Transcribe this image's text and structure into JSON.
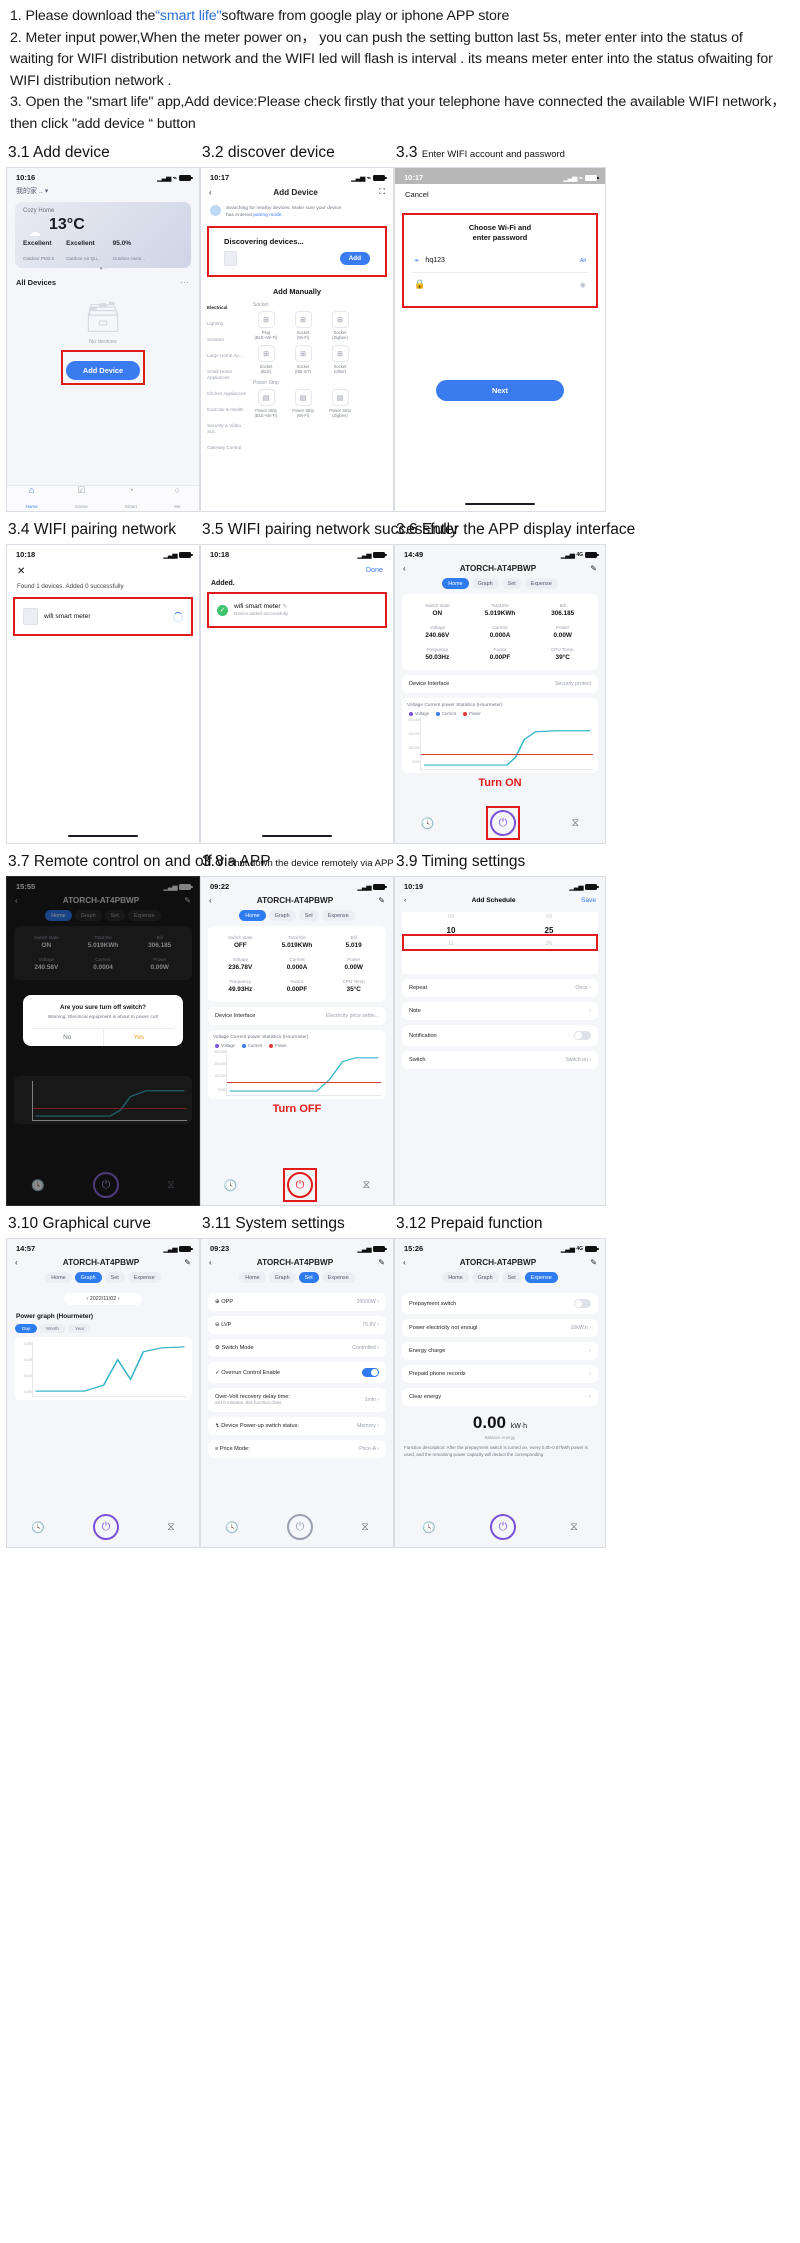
{
  "intro": {
    "line1_a": "1. Please download the",
    "line1_link": "“smart life\"",
    "line1_b": "software from google play or  iphone APP store",
    "line2": "2. Meter input power,When the meter power on， you can push the setting button last 5s, meter enter into the status of waiting for WIFI distribution network and the WIFI led will flash is interval . its means meter enter into the status ofwaiting for WIFI distribution network .",
    "line3": "3. Open the \"smart life\" app,Add device:Please check firstly that your telephone have connected the available WIFI network， then click \"add device “ button"
  },
  "sections": {
    "s31": {
      "num": "3.1",
      "title": "Add device"
    },
    "s32": {
      "num": "3.2",
      "title": "discover device"
    },
    "s33": {
      "num": "3.3",
      "title": "Enter WIFI account and password"
    },
    "s34": {
      "num": "3.4",
      "title": "WIFI pairing network"
    },
    "s35": {
      "num": "3.5",
      "title": "WIFI pairing network successfully"
    },
    "s36": {
      "num": "3.6",
      "title": "Enter the APP display interface"
    },
    "s37": {
      "num": "3.7",
      "title": "Remote control on and off via APP"
    },
    "s38": {
      "num": "3.8",
      "title": "Shut down the device remotely via APP"
    },
    "s39": {
      "num": "3.9",
      "title": "Timing settings"
    },
    "s310": {
      "num": "3.10",
      "title": "Graphical curve"
    },
    "s311": {
      "num": "3.11",
      "title": "System settings"
    },
    "s312": {
      "num": "3.12",
      "title": "Prepaid function"
    }
  },
  "phone31": {
    "time": "10:16",
    "home_name": "我的家 ..",
    "card_title": "Cozy Home",
    "temp": "13°C",
    "m1_value": "Excellent",
    "m1_label": "Outdoor PM2.5",
    "m2_value": "Excellent",
    "m2_label": "Outdoor Air Qu...",
    "m3_value": "95.0%",
    "m3_label": "Outdoor Humi...",
    "all_devices": "All Devices",
    "no_devices": "No devices",
    "add_device": "Add Device",
    "tabs": [
      {
        "icon": "⌂",
        "label": "Home"
      },
      {
        "icon": "☑",
        "label": "Scene"
      },
      {
        "icon": "◔",
        "label": "Smart"
      },
      {
        "icon": "○",
        "label": "Me"
      }
    ]
  },
  "phone32": {
    "time": "10:17",
    "title": "Add Device",
    "note_a": "Searching for nearby devices. Make sure your device",
    "note_b": "has entered ",
    "note_link": "pairing mode.",
    "discovering": "Discovering devices...",
    "add_btn": "Add",
    "add_manually": "Add Manually",
    "categories": [
      "Electrical",
      "Lighting",
      "Sensors",
      "Large Home Ap...",
      "Small Home Appliances",
      "Kitchen Appliances",
      "Exercise & Health",
      "Security & Video Sur...",
      "Gateway Control"
    ],
    "group1": "Socket",
    "products1": [
      {
        "name": "Plug",
        "sub": "(BLE+Wi-Fi)"
      },
      {
        "name": "Socket",
        "sub": "(Wi-Fi)"
      },
      {
        "name": "Socket",
        "sub": "(Zigbee)"
      },
      {
        "name": "Socket",
        "sub": "(BLE)"
      },
      {
        "name": "Socket",
        "sub": "(NB-IoT)"
      },
      {
        "name": "Socket",
        "sub": "(other)"
      }
    ],
    "group2": "Power Strip",
    "products2": [
      {
        "name": "Power Strip",
        "sub": "(BLE+Wi-Fi)"
      },
      {
        "name": "Power Strip",
        "sub": "(Wi-Fi)"
      },
      {
        "name": "Power Strip",
        "sub": "(Zigbee)"
      }
    ]
  },
  "phone33": {
    "time": "10:17",
    "cancel": "Cancel",
    "title_l1": "Choose Wi-Fi and",
    "title_l2": "enter password",
    "ssid": "hq123",
    "switch": "Alt",
    "next": "Next"
  },
  "phone34": {
    "time": "10:18",
    "found": "Found 1 devices. Added 0 successfully",
    "device": "wifi smart meter"
  },
  "phone35": {
    "time": "10:18",
    "done": "Done",
    "added": "Added.",
    "device": "wifi smart meter",
    "sub": "Device added successfully"
  },
  "phone36": {
    "time": "14:49",
    "title": "ATORCH-AT4PBWP",
    "tabs": [
      "Home",
      "Graph",
      "Set",
      "Expense"
    ],
    "metrics": [
      {
        "k": "Switch state",
        "v": "ON"
      },
      {
        "k": "Total Ele",
        "v": "5.019KWh"
      },
      {
        "k": "Bill",
        "v": "306.185"
      },
      {
        "k": "Voltage",
        "v": "240.66V"
      },
      {
        "k": "Current",
        "v": "0.000A"
      },
      {
        "k": "Power",
        "v": "0.00W"
      },
      {
        "k": "Frequency",
        "v": "50.03Hz"
      },
      {
        "k": "Factor",
        "v": "0.00PF"
      },
      {
        "k": "CPU Temp.",
        "v": "39°C"
      }
    ],
    "row1_l": "Device Interface",
    "row1_r": "Security protect",
    "chart_title": "Voltage Current power Statistics (Hourmeter)",
    "legend": [
      "Voltage",
      "Current",
      "Power"
    ],
    "turn": "Turn ON"
  },
  "phone37": {
    "time": "15:55",
    "title": "ATORCH-AT4PBWP",
    "tabs": [
      "Home",
      "Graph",
      "Set",
      "Expense"
    ],
    "metrics": [
      {
        "k": "Switch state",
        "v": "ON"
      },
      {
        "k": "Total Ele",
        "v": "5.019KWh"
      },
      {
        "k": "Bill",
        "v": "306.185"
      },
      {
        "k": "Voltage",
        "v": "240.58V"
      },
      {
        "k": "Current",
        "v": "0.0004"
      },
      {
        "k": "Power",
        "v": "0.00W"
      }
    ],
    "dialog_title": "Are you sure turn off switch?",
    "dialog_body": "Warning: Electrical equipment is about to power cut!",
    "dialog_no": "No",
    "dialog_yes": "Yes"
  },
  "phone38": {
    "time": "09:22",
    "title": "ATORCH-AT4PBWP",
    "tabs": [
      "Home",
      "Graph",
      "Set",
      "Expense"
    ],
    "metrics": [
      {
        "k": "Switch state",
        "v": "OFF"
      },
      {
        "k": "Total Ele",
        "v": "5.019KWh"
      },
      {
        "k": "Bill",
        "v": "5.019"
      },
      {
        "k": "Voltage",
        "v": "236.78V"
      },
      {
        "k": "Current",
        "v": "0.000A"
      },
      {
        "k": "Power",
        "v": "0.00W"
      },
      {
        "k": "Frequency",
        "v": "49.93Hz"
      },
      {
        "k": "Factor",
        "v": "0.00PF"
      },
      {
        "k": "CPU Temp",
        "v": "35°C"
      }
    ],
    "row1_l": "Device Interface",
    "row1_r": "Electricity price settin...",
    "chart_title": "Voltage Current power Statistics (Hourmeter)",
    "legend": [
      "Voltage",
      "Current",
      "Power"
    ],
    "turn": "Turn OFF"
  },
  "phone39": {
    "time": "10:19",
    "title": "Add Schedule",
    "save": "Save",
    "hours": [
      "09",
      "10",
      "11"
    ],
    "mins": [
      "24",
      "25",
      "26"
    ],
    "rows": [
      {
        "l": "Repeat",
        "r": "Once"
      },
      {
        "l": "Note",
        "r": ""
      },
      {
        "l": "Notification",
        "r": ""
      },
      {
        "l": "Switch",
        "r": "Switch on"
      }
    ]
  },
  "phone310": {
    "time": "14:57",
    "title": "ATORCH-AT4PBWP",
    "tabs": [
      "Home",
      "Graph",
      "Set",
      "Expense"
    ],
    "date": "2022/11/02",
    "graph_title": "Power graph (Hourmeter)",
    "segs": [
      "Day",
      "Month",
      "Year"
    ]
  },
  "phone311": {
    "time": "09:23",
    "title": "ATORCH-AT4PBWP",
    "tabs": [
      "Home",
      "Graph",
      "Set",
      "Expense"
    ],
    "rows": [
      {
        "l": "OPP",
        "r": "26500W"
      },
      {
        "l": "LVP",
        "r": "75.8V"
      },
      {
        "l": "Switch Mode",
        "r": "Controlled"
      },
      {
        "l": "Overrun Control Enable",
        "r": "toggle-on"
      },
      {
        "l": "Over-Volt recovery delay time:",
        "sub": "Set 0 minutes, this function does",
        "r": "1min"
      },
      {
        "l": "Device Power-up switch status:",
        "r": "Memory"
      },
      {
        "l": "Price Mode:",
        "r": "Price-A"
      }
    ]
  },
  "phone312": {
    "time": "15:26",
    "title": "ATORCH-AT4PBWP",
    "tabs": [
      "Home",
      "Graph",
      "Set",
      "Expense"
    ],
    "rows": [
      {
        "l": "Prepayment switch",
        "r": "toggle-off"
      },
      {
        "l": "Power electricity not enougl",
        "r": "10kW.h"
      },
      {
        "l": "Energy charge",
        "r": ""
      },
      {
        "l": "Prepaid phone records",
        "r": ""
      },
      {
        "l": "Clear energy",
        "r": ""
      }
    ],
    "big": "0.00",
    "big_unit": "kW·h",
    "balance": "Balance energy",
    "desc": "Function description: After the prepayment switch is turned on, every 0.0b-0.07kWh power is used, and the remaining power capacity will deduct the corresponding"
  },
  "colors": {
    "accent": "#3b7bf0",
    "red": "#e01b1b",
    "link": "#2a6fd6",
    "purple": "#7b52d8"
  }
}
